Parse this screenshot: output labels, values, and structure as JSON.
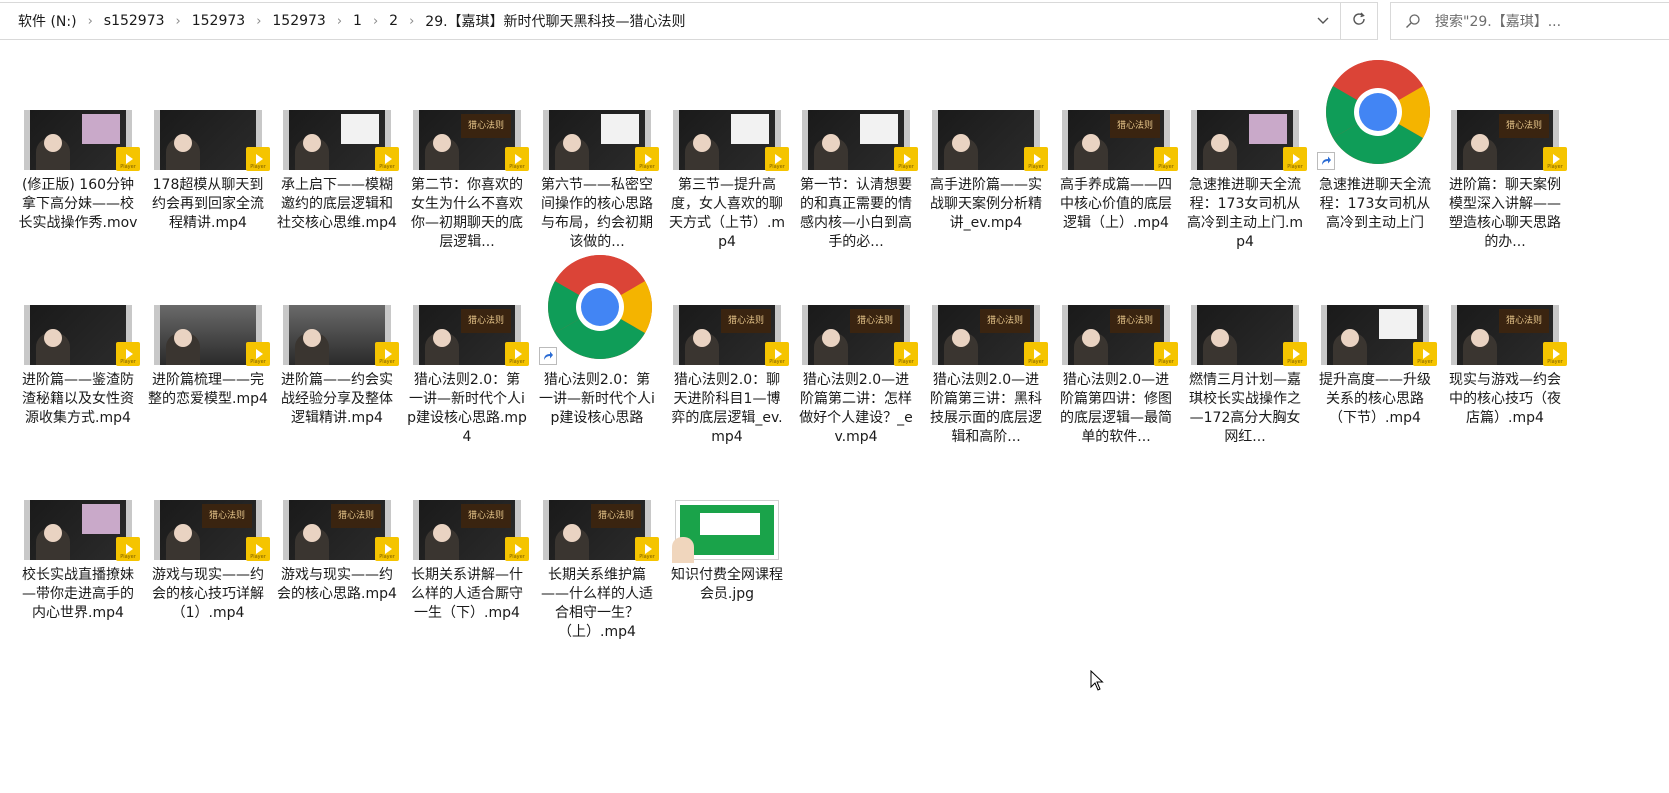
{
  "address_bar": {
    "breadcrumbs": [
      "软件 (N:)",
      "s152973",
      "152973",
      "152973",
      "1",
      "2",
      "29.【嘉琪】新时代聊天黑科技—猎心法则"
    ]
  },
  "search": {
    "placeholder": "搜索\"29.【嘉琪】..."
  },
  "colors": {
    "play_badge": "#f5c400",
    "chrome_red": "#db4437",
    "chrome_green": "#0f9d58",
    "chrome_yellow": "#f4b400",
    "chrome_blue": "#4285f4",
    "image_green": "#1aa34a"
  },
  "files": [
    {
      "name": "(修正版) 160分钟拿下高分妹——校长实战操作秀.mov",
      "type": "video",
      "variant": "a"
    },
    {
      "name": "178超模从聊天到约会再到回家全流程精讲.mp4",
      "type": "video",
      "variant": "b"
    },
    {
      "name": "承上启下——模糊邀约的底层逻辑和社交核心思维.mp4",
      "type": "video",
      "variant": "c"
    },
    {
      "name": "第二节：你喜欢的女生为什么不喜欢你—初期聊天的底层逻辑...",
      "type": "video",
      "variant": "d"
    },
    {
      "name": "第六节——私密空间操作的核心思路与布局，约会初期该做的...",
      "type": "video",
      "variant": "c"
    },
    {
      "name": "第三节—提升高度，女人喜欢的聊天方式（上节）.mp4",
      "type": "video",
      "variant": "c"
    },
    {
      "name": "第一节：认清想要的和真正需要的情感内核—小白到高手的必...",
      "type": "video",
      "variant": "c"
    },
    {
      "name": "高手进阶篇——实战聊天案例分析精讲_ev.mp4",
      "type": "video",
      "variant": "b"
    },
    {
      "name": "高手养成篇——四中核心价值的底层逻辑（上）.mp4",
      "type": "video",
      "variant": "d"
    },
    {
      "name": "急速推进聊天全流程：173女司机从高冷到主动上门.mp4",
      "type": "video",
      "variant": "a"
    },
    {
      "name": "急速推进聊天全流程：173女司机从高冷到主动上门",
      "type": "chrome"
    },
    {
      "name": "进阶篇：聊天案例模型深入讲解——塑造核心聊天思路的办...",
      "type": "video",
      "variant": "d"
    },
    {
      "name": "进阶篇——鉴渣防渣秘籍以及女性资源收集方式.mp4",
      "type": "video",
      "variant": "b"
    },
    {
      "name": "进阶篇梳理——完整的恋爱模型.mp4",
      "type": "video",
      "variant": "e"
    },
    {
      "name": "进阶篇——约会实战经验分享及整体逻辑精讲.mp4",
      "type": "video",
      "variant": "e"
    },
    {
      "name": "猎心法则2.0：第一讲—新时代个人ip建设核心思路.mp4",
      "type": "video",
      "variant": "d"
    },
    {
      "name": "猎心法则2.0：第一讲—新时代个人ip建设核心思路",
      "type": "chrome"
    },
    {
      "name": "猎心法则2.0：聊天进阶科目1—博弈的底层逻辑_ev.mp4",
      "type": "video",
      "variant": "d"
    },
    {
      "name": "猎心法则2.0—进阶篇第二讲：怎样做好个人建设？_ev.mp4",
      "type": "video",
      "variant": "d"
    },
    {
      "name": "猎心法则2.0—进阶篇第三讲：黑科技展示面的底层逻辑和高阶...",
      "type": "video",
      "variant": "d"
    },
    {
      "name": "猎心法则2.0—进阶篇第四讲：修图的底层逻辑—最简单的软件...",
      "type": "video",
      "variant": "d"
    },
    {
      "name": "燃情三月计划—嘉琪校长实战操作之—172高分大胸女网红...",
      "type": "video",
      "variant": "b"
    },
    {
      "name": "提升高度——升级关系的核心思路（下节）.mp4",
      "type": "video",
      "variant": "c"
    },
    {
      "name": "现实与游戏—约会中的核心技巧（夜店篇）.mp4",
      "type": "video",
      "variant": "d"
    },
    {
      "name": "校长实战直播撩妹—带你走进高手的内心世界.mp4",
      "type": "video",
      "variant": "a"
    },
    {
      "name": "游戏与现实——约会的核心技巧详解（1）.mp4",
      "type": "video",
      "variant": "d"
    },
    {
      "name": "游戏与现实——约会的核心思路.mp4",
      "type": "video",
      "variant": "d"
    },
    {
      "name": "长期关系讲解—什么样的人适合厮守一生（下）.mp4",
      "type": "video",
      "variant": "d"
    },
    {
      "name": "长期关系维护篇——什么样的人适合相守一生？（上）.mp4",
      "type": "video",
      "variant": "d"
    },
    {
      "name": "知识付费全网课程会员.jpg",
      "type": "image"
    }
  ],
  "thumb_text": {
    "banner": "猎心法则",
    "play": "Player"
  }
}
